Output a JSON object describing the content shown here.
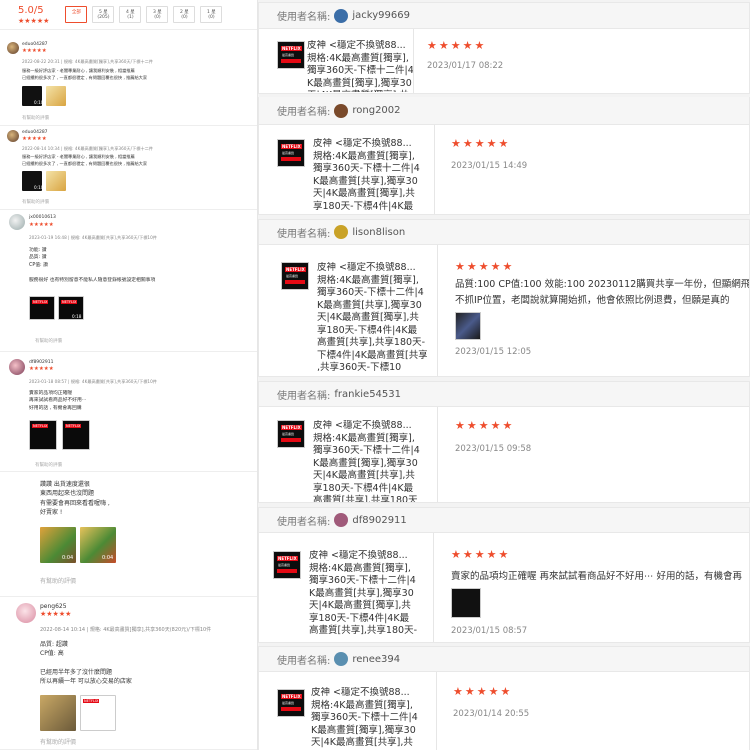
{
  "left_panel": {
    "rating": {
      "score": "5.0/5",
      "stars": "★★★★★"
    },
    "filters": [
      {
        "label": "全部",
        "active": true
      },
      {
        "label": "5 星 (205)",
        "active": false
      },
      {
        "label": "4 星 (1)",
        "active": false
      },
      {
        "label": "3 星 (0)",
        "active": false
      },
      {
        "label": "2 星 (0)",
        "active": false
      },
      {
        "label": "1 星 (0)",
        "active": false
      }
    ],
    "reviews": [
      {
        "name": "eduo04287",
        "stars": "★★★★★",
        "meta": "2022-08-22 20:31 | 規格: 4K最高畫質[獨享],共享360天/下標十二件",
        "text": "服務一級好評店家 - 老闆專業耐心 , 讓我順利安裝 , 相當推薦\n已經續約很多次了 , 一直都很穩定 , 有問題回覆也很快 , 推薦給大家",
        "help": "有幫助的評價"
      },
      {
        "name": "eduo04287",
        "stars": "★★★★★",
        "meta": "2022-08-14 10:34 | 規格: 4K最高畫質[獨享],共享360天/下標十二件",
        "text": "服務一級好評店家 - 老闆專業耐心 , 讓我順利安裝 , 相當推薦\n已經續約很多次了 , 一直都很穩定 , 有問題回覆也很快 , 推薦給大家",
        "help": "有幫助的評價"
      },
      {
        "name": "jx00010613",
        "stars": "★★★★★",
        "meta": "2023-01-19 16:48 | 規格: 4K最高畫質[共享],共享360天/下標10件",
        "text": "功能: 讚\n品質: 讚\nCP值: 讚\n\n服務很好 也有特別留意不能私人隨意登錄帳號設定相關事項",
        "help": "有幫助的評價"
      },
      {
        "name": "df8902911",
        "stars": "★★★★★",
        "meta": "2023-01-18 08:57 | 規格: 4K最高畫質[共享],共享360天/下標10件",
        "text": "賣家的品項均正確喔\n再來試試看商品好不好用⋯\n好用的話 , 有機會再回購",
        "help": "有幫助的評價"
      },
      {
        "name": "",
        "stars": "",
        "meta": "",
        "text": "讚讚 出貨速度還很\n東西用起來也沒問題\n有需要會再回來看看喔嗨 ,\n好賣家 !",
        "help": "有幫助的評價"
      },
      {
        "name": "peng625",
        "stars": "★★★★★",
        "meta": "2022-08-14 10:14 | 規格: 4K最高畫質[獨享],共享360天(820元)/下標10件",
        "text": "品質: 超讚\nCP值: 高\n\n已經用半年多了沒什麼問題\n所以再續一年 可以放心交易的店家",
        "help": "有幫助的評價"
      }
    ],
    "video_durations": [
      "0:10",
      "0:10",
      "0:18",
      "0:04",
      "0:04"
    ]
  },
  "right_panel": {
    "user_label": "使用者名稱:",
    "product_badge": {
      "logo": "NETFLIX",
      "sub": "最高畫質",
      "bar": "全平臺國際"
    },
    "cards": [
      {
        "username": "jacky99669",
        "avatar_color": "#3b6ea8",
        "product": "皮神 <穩定不換號88...\n規格:4K最高畫質[獨享],\n獨享360天-下標十二件|4\nK最高畫質[獨享],獨享30\n天|4K最高畫質[獨享],共",
        "stars": "★★★★★",
        "text": "",
        "date": "2023/01/17 08:22"
      },
      {
        "username": "rong2002",
        "avatar_color": "#7a4a2b",
        "product": "皮神 <穩定不換號88...\n規格:4K最高畫質[獨享],\n獨享360天-下標十二件|4\nK最高畫質[共享],獨享30\n天|4K最高畫質[獨享],共\n享180天-下標4件|4K最",
        "stars": "★★★★★",
        "text": "",
        "date": "2023/01/15 14:49"
      },
      {
        "username": "lison8lison",
        "avatar_color": "#c9a227",
        "product": "皮神 <穩定不換號88...\n規格:4K最高畫質[獨享],\n獨享360天-下標十二件|4\nK最高畫質[共享],獨享30\n天|4K最高畫質[獨享],共\n享180天-下標4件|4K最\n高畫質[共享],共享180天-\n下標4件|4K最高畫質[共享]\n,共享360天-下標10",
        "stars": "★★★★★",
        "text": "品質:100 CP值:100 效能:100 20230112購買共享一年份，但顯網飛遊\n不抓IP位置，老闆說就算開始抓，他會依照比例退費，但願是真的",
        "date": "2023/01/15 12:05"
      },
      {
        "username": "frankie54531",
        "avatar_color": "#888888",
        "product": "皮神 <穩定不換號88...\n規格:4K最高畫質[獨享],\n獨享360天-下標十二件|4\nK最高畫質[獨享],獨享30\n天|4K最高畫質[共享],共\n享180天-下標4件|4K最\n高畫質[共享],共享180天",
        "stars": "★★★★★",
        "text": "",
        "date": "2023/01/15 09:58"
      },
      {
        "username": "df8902911",
        "avatar_color": "#a05a7a",
        "product": "皮神 <穩定不換號88...\n規格:4K最高畫質[獨享],\n獨享360天-下標十二件|4\nK最高畫質[共享],獨享30\n天|4K最高畫質[獨享],共\n享180天-下標4件|4K最\n高畫質[共享],共享180天-",
        "stars": "★★★★★",
        "text": "賣家的品項均正確喔 再來試試看商品好不好用⋯ 好用的話，有機會再",
        "date": "2023/01/15 08:57"
      },
      {
        "username": "renee394",
        "avatar_color": "#5a8fb0",
        "product": "皮神 <穩定不換號88...\n規格:4K最高畫質[獨享],\n獨享360天-下標十二件|4\nK最高畫質[獨享],獨享30\n天|4K最高畫質[共享],共",
        "stars": "★★★★★",
        "text": "",
        "date": "2023/01/14 20:55"
      }
    ]
  }
}
